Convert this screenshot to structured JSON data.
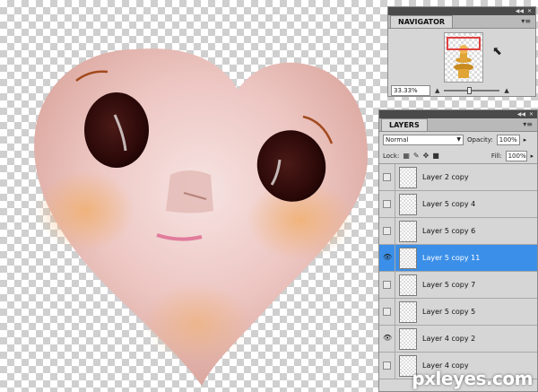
{
  "navigator": {
    "title": "NAVIGATOR",
    "zoom": "33.33%",
    "zoom_slider_fraction": 0.45
  },
  "layers": {
    "title": "LAYERS",
    "blend_mode": "Normal",
    "opacity_label": "Opacity:",
    "opacity_value": "100%",
    "lock_label": "Lock:",
    "fill_label": "Fill:",
    "fill_value": "100%",
    "items": [
      {
        "name": "Layer 2 copy",
        "visible": false,
        "selected": false
      },
      {
        "name": "Layer 5 copy 4",
        "visible": false,
        "selected": false
      },
      {
        "name": "Layer 5 copy 6",
        "visible": false,
        "selected": false
      },
      {
        "name": "Layer 5 copy 11",
        "visible": true,
        "selected": true
      },
      {
        "name": "Layer 5 copy 7",
        "visible": false,
        "selected": false
      },
      {
        "name": "Layer 5 copy 5",
        "visible": false,
        "selected": false
      },
      {
        "name": "Layer 4 copy 2",
        "visible": true,
        "selected": false
      },
      {
        "name": "Layer 4 copy",
        "visible": false,
        "selected": false
      }
    ]
  },
  "watermark": "pxleyes.com",
  "colors": {
    "selection": "#3b8fe8",
    "panel_bg": "#d6d6d6"
  }
}
